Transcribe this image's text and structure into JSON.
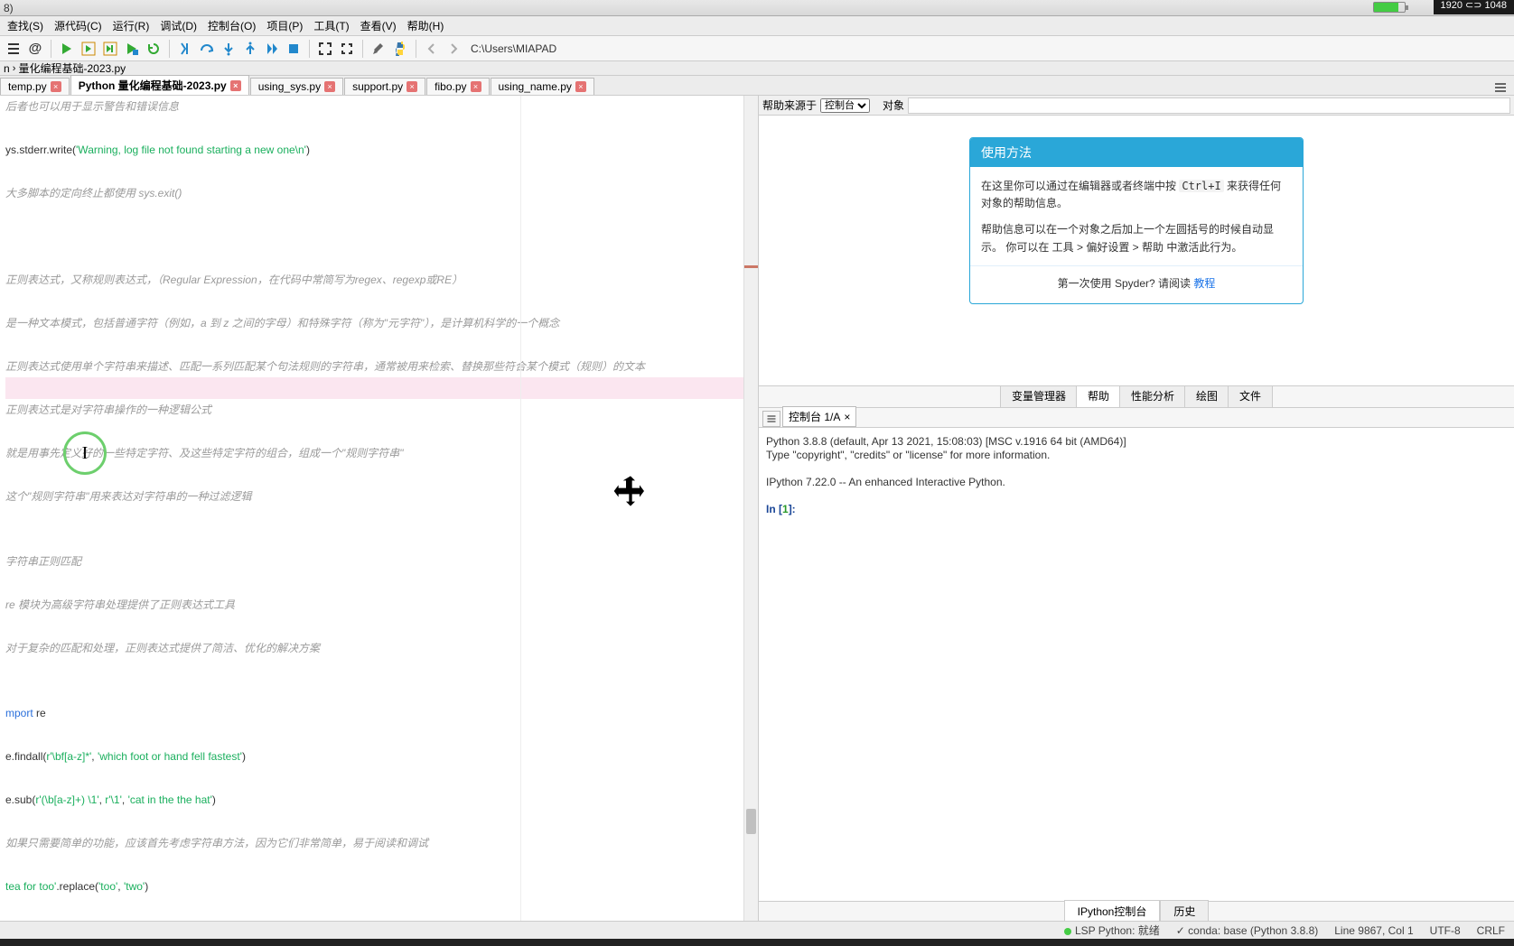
{
  "titlebar": {
    "text": "8)",
    "resolution": "1920 ⊂⊃ 1048"
  },
  "menu": [
    "查找(S)",
    "源代码(C)",
    "运行(R)",
    "调试(D)",
    "控制台(O)",
    "项目(P)",
    "工具(T)",
    "查看(V)",
    "帮助(H)"
  ],
  "toolbar_path": "C:\\Users\\MIAPAD",
  "breadcrumb": [
    "n",
    "量化编程基础-2023.py"
  ],
  "file_tabs": [
    {
      "label": "temp.py",
      "active": false
    },
    {
      "label": "Python 量化编程基础-2023.py",
      "active": true
    },
    {
      "label": "using_sys.py",
      "active": false
    },
    {
      "label": "support.py",
      "active": false
    },
    {
      "label": "fibo.py",
      "active": false
    },
    {
      "label": "using_name.py",
      "active": false
    }
  ],
  "code_lines": [
    {
      "type": "cm",
      "text": "后者也可以用于显示警告和错误信息"
    },
    {
      "type": "blank"
    },
    {
      "type": "code",
      "prefix": "ys.stderr.write(",
      "str": "'Warning, log file not found starting a new one\\n'",
      "suffix": ")"
    },
    {
      "type": "blank"
    },
    {
      "type": "cm",
      "text": "大多脚本的定向终止都使用   sys.exit()"
    },
    {
      "type": "blank"
    },
    {
      "type": "blank"
    },
    {
      "type": "blank"
    },
    {
      "type": "cm",
      "text": "正则表达式，又称规则表达式，（Regular Expression，在代码中常简写为regex、regexp或RE）"
    },
    {
      "type": "blank"
    },
    {
      "type": "cm",
      "text": "是一种文本模式，包括普通字符（例如，a  到  z  之间的字母）和特殊字符（称为\"元字符\"），是计算机科学的一个概念"
    },
    {
      "type": "blank"
    },
    {
      "type": "cm",
      "text": "正则表达式使用单个字符串来描述、匹配一系列匹配某个句法规则的字符串，通常被用来检索、替换那些符合某个模式（规则）的文本"
    },
    {
      "type": "hl"
    },
    {
      "type": "cm",
      "text": "正则表达式是对字符串操作的一种逻辑公式"
    },
    {
      "type": "blank"
    },
    {
      "type": "cm",
      "text": "就是用事先定义好的一些特定字符、及这些特定字符的组合，组成一个\"规则字符串\""
    },
    {
      "type": "blank"
    },
    {
      "type": "cm",
      "text": "这个\"规则字符串\"用来表达对字符串的一种过滤逻辑"
    },
    {
      "type": "blank"
    },
    {
      "type": "blank"
    },
    {
      "type": "cm",
      "text": "字符串正则匹配"
    },
    {
      "type": "blank"
    },
    {
      "type": "cm",
      "text": "re  模块为高级字符串处理提供了正则表达式工具"
    },
    {
      "type": "blank"
    },
    {
      "type": "cm",
      "text": "对于复杂的匹配和处理，正则表达式提供了简洁、优化的解决方案"
    },
    {
      "type": "blank"
    },
    {
      "type": "blank"
    },
    {
      "type": "import",
      "kw": "mport",
      "mod": " re"
    },
    {
      "type": "blank"
    },
    {
      "type": "call",
      "prefix": "e.findall(",
      "args": [
        "r'\\bf[a-z]*'",
        ", ",
        "'which foot or hand fell fastest'"
      ],
      "suffix": ")"
    },
    {
      "type": "blank"
    },
    {
      "type": "call",
      "prefix": "e.sub(",
      "args": [
        "r'(\\b[a-z]+) \\1'",
        ", ",
        "r'\\1'",
        ", ",
        "'cat in the the hat'"
      ],
      "suffix": ")"
    },
    {
      "type": "blank"
    },
    {
      "type": "cm",
      "text": "如果只需要简单的功能，应该首先考虑字符串方法，因为它们非常简单，易于阅读和调试"
    },
    {
      "type": "blank"
    },
    {
      "type": "call",
      "prefix": "tea for too'",
      ".method": ".replace(",
      "args": [
        "'too'",
        ", ",
        "'two'"
      ],
      "suffix": ")"
    }
  ],
  "help": {
    "label_source": "帮助来源于",
    "select": "控制台",
    "obj_label": "对象",
    "card_title": "使用方法",
    "body1_pre": "在这里你可以通过在编辑器或者终端中按 ",
    "body1_kbd": "Ctrl+I",
    "body1_post": " 来获得任何对象的帮助信息。",
    "body2": "帮助信息可以在一个对象之后加上一个左圆括号的时候自动显示。 你可以在 工具 > 偏好设置 > 帮助 中激活此行为。",
    "footer_pre": "第一次使用 Spyder? 请阅读 ",
    "footer_link": "教程"
  },
  "side_tabs": [
    "变量管理器",
    "帮助",
    "性能分析",
    "绘图",
    "文件"
  ],
  "side_active": "帮助",
  "console_tab": "控制台 1/A",
  "console_lines": {
    "l1": "Python 3.8.8 (default, Apr 13 2021, 15:08:03) [MSC v.1916 64 bit (AMD64)]",
    "l2": "Type \"copyright\", \"credits\" or \"license\" for more information.",
    "l3": "IPython 7.22.0 -- An enhanced Interactive Python.",
    "l4_pre": "In [",
    "l4_num": "1",
    "l4_post": "]:"
  },
  "bottom_tabs": [
    "IPython控制台",
    "历史"
  ],
  "bottom_active": "IPython控制台",
  "status": {
    "lsp": "LSP Python: 就绪",
    "conda": "conda: base (Python 3.8.8)",
    "line": "Line 9867, Col 1",
    "enc": "UTF-8",
    "eol": "CRLF"
  }
}
